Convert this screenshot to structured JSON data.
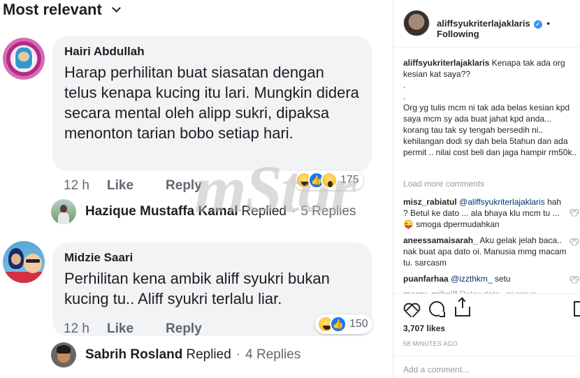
{
  "facebook": {
    "sort_label": "Most relevant",
    "comments": [
      {
        "author": "Hairi Abdullah",
        "text": "Harap perhilitan buat siasatan dengan telus kenapa kucing itu lari. Mungkin didera secara mental oleh alipp sukri, dipaksa menonton tarian bobo setiap hari.",
        "time": "12 h",
        "like_label": "Like",
        "reply_label": "Reply",
        "reaction_count": "175",
        "reactions": [
          "haha",
          "like",
          "wow"
        ],
        "reply_summary": {
          "name": "Hazique Mustaffa Kamal",
          "replied": "Replied",
          "dot": "·",
          "count": "5 Replies"
        }
      },
      {
        "author": "Midzie Saari",
        "text": "Perhilitan kena ambik aliff syukri bukan kucing tu.. Aliff syukri terlalu liar.",
        "time": "12 h",
        "like_label": "Like",
        "reply_label": "Reply",
        "reaction_count": "150",
        "reactions": [
          "haha",
          "like"
        ],
        "reply_summary": {
          "name": "Sabrih Rosland",
          "replied": "Replied",
          "dot": "·",
          "count": "4 Replies"
        }
      }
    ],
    "watermark": "mStar"
  },
  "instagram": {
    "username": "aliffsyukriterlajaklaris",
    "verified_icon": "verified-badge-icon",
    "separator": "•",
    "follow_label": "Following",
    "caption_user": "aliffsyukriterlajaklaris",
    "caption_line1": "Kenapa tak ada org kesian kat saya??",
    "caption_dot1": ".",
    "caption_dot2": ".",
    "caption_body": "Org yg tulis mcm ni tak ada belas kesian kpd saya mcm sy ada buat jahat kpd anda... korang tau tak sy tengah bersedih ni.. kehilangan dodi sy dah bela 5tahun dan ada permit .. nilai cost beli dan jaga hampir rm50k..",
    "load_more": "Load more comments",
    "comments": [
      {
        "user": "misz_rabiatul",
        "mention": "@aliffsyukriterlajaklaris",
        "text": "hah ? Betul ke dato ... ala bhaya klu mcm tu ... 😜 smoga dpermudahkan"
      },
      {
        "user": "aneessamaisarah_",
        "mention": "",
        "text": "Aku gelak jelah baca.. nak buat apa dato oi. Manusia mmg macam tu. sarcasm"
      },
      {
        "user": "puanfarhaa",
        "mention": "@izzthkm_",
        "text": "setu"
      },
      {
        "user": "merry_mikaill",
        "mention": "",
        "text": "Relax dato.. ni smua"
      }
    ],
    "likes": "3,707 likes",
    "time_ago": "58 MINUTES AGO",
    "add_comment_placeholder": "Add a comment..."
  }
}
